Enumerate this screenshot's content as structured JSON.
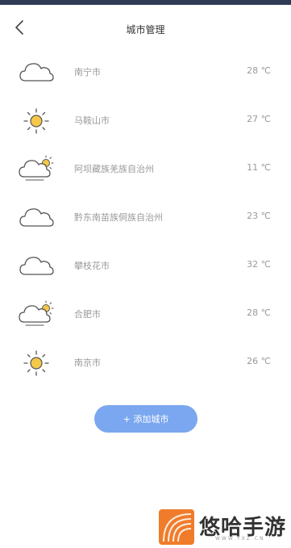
{
  "header": {
    "title": "城市管理",
    "back_icon": "chevron-left-icon"
  },
  "cities": [
    {
      "name": "南宁市",
      "temp": "28 ℃",
      "icon": "cloud"
    },
    {
      "name": "马鞍山市",
      "temp": "27 ℃",
      "icon": "sun"
    },
    {
      "name": "阿坝藏族羌族自治州",
      "temp": "11 ℃",
      "icon": "partly-cloudy"
    },
    {
      "name": "黔东南苗族侗族自治州",
      "temp": "23 ℃",
      "icon": "cloud"
    },
    {
      "name": "攀枝花市",
      "temp": "32 ℃",
      "icon": "cloud"
    },
    {
      "name": "合肥市",
      "temp": "28 ℃",
      "icon": "partly-cloudy"
    },
    {
      "name": "南京市",
      "temp": "26 ℃",
      "icon": "sun"
    }
  ],
  "add_button": {
    "label": "+ 添加城市"
  },
  "watermark": {
    "text": "悠哈手游",
    "domain": "WWW.YXZ.CN"
  },
  "colors": {
    "accent": "#7aa7ef",
    "sun": "#f5c84a",
    "text_muted": "#9a9a9a"
  }
}
